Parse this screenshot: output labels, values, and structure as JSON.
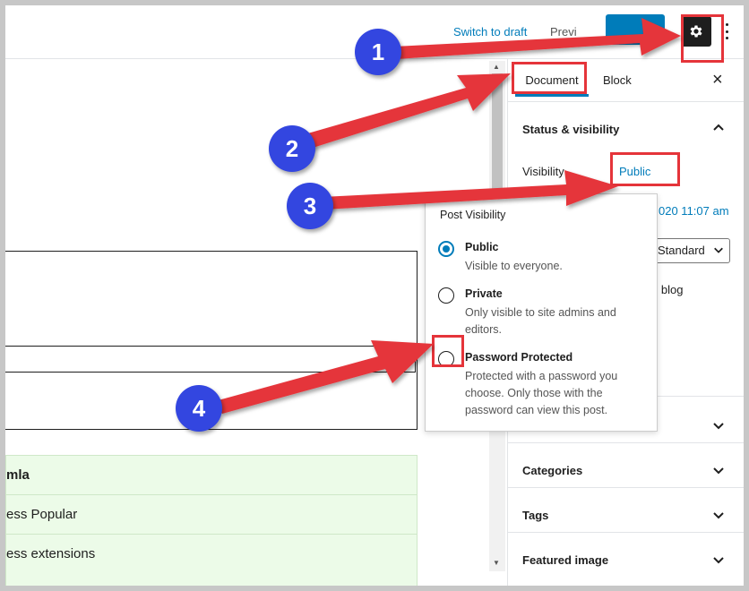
{
  "topbar": {
    "switch_to_draft": "Switch to draft",
    "preview": "Previ"
  },
  "editor": {
    "green_rows": [
      "mla",
      "ess Popular",
      "ess extensions"
    ]
  },
  "sidebar": {
    "tabs": {
      "document": "Document",
      "block": "Block"
    },
    "close": "×",
    "status_visibility": "Status & visibility",
    "visibility_label": "Visibility",
    "visibility_value": "Public",
    "publish_date": "020 11:07 am",
    "format_value": "Standard",
    "stick_text": "e blog",
    "categories": "Categories",
    "tags": "Tags",
    "featured_image": "Featured image"
  },
  "popover": {
    "title": "Post Visibility",
    "options": [
      {
        "label": "Public",
        "desc": "Visible to everyone.",
        "checked": true
      },
      {
        "label": "Private",
        "desc": "Only visible to site admins and editors.",
        "checked": false
      },
      {
        "label": "Password Protected",
        "desc": "Protected with a password you choose. Only those with the password can view this post.",
        "checked": false
      }
    ]
  },
  "annotations": {
    "badges": [
      "1",
      "2",
      "3",
      "4"
    ],
    "arrow_color": "#e5343a",
    "badge_color": "#3346e0"
  }
}
